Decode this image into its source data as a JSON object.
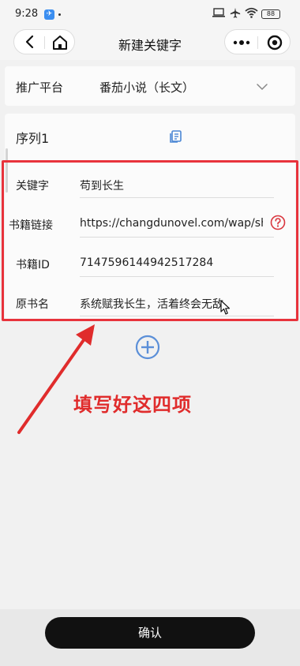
{
  "status_bar": {
    "time": "9:28",
    "battery": "88",
    "icons": [
      "app-notification-icon",
      "laptop-icon",
      "airplane-icon",
      "wifi-icon",
      "battery-icon"
    ]
  },
  "nav": {
    "title": "新建关键字",
    "icons": [
      "back-icon",
      "home-icon",
      "more-icon",
      "target-icon"
    ]
  },
  "platform": {
    "label": "推广平台",
    "value": "番茄小说（长文）"
  },
  "sequence": {
    "title": "序列1",
    "fields": [
      {
        "label": "关键字",
        "value": "苟到长生"
      },
      {
        "label": "书籍链接",
        "value": "https://changdunovel.com/wap/share"
      },
      {
        "label": "书籍ID",
        "value": "7147596144942517284"
      },
      {
        "label": "原书名",
        "value": "系统赋我长生，活着终会无敌"
      }
    ]
  },
  "annotation": {
    "text": "填写好这四项",
    "color": "#e02c2c"
  },
  "confirm_button": "确认",
  "colors": {
    "accent_blue": "#5b8fd8",
    "highlight_red": "#e8333c",
    "button_dark": "#111111"
  }
}
